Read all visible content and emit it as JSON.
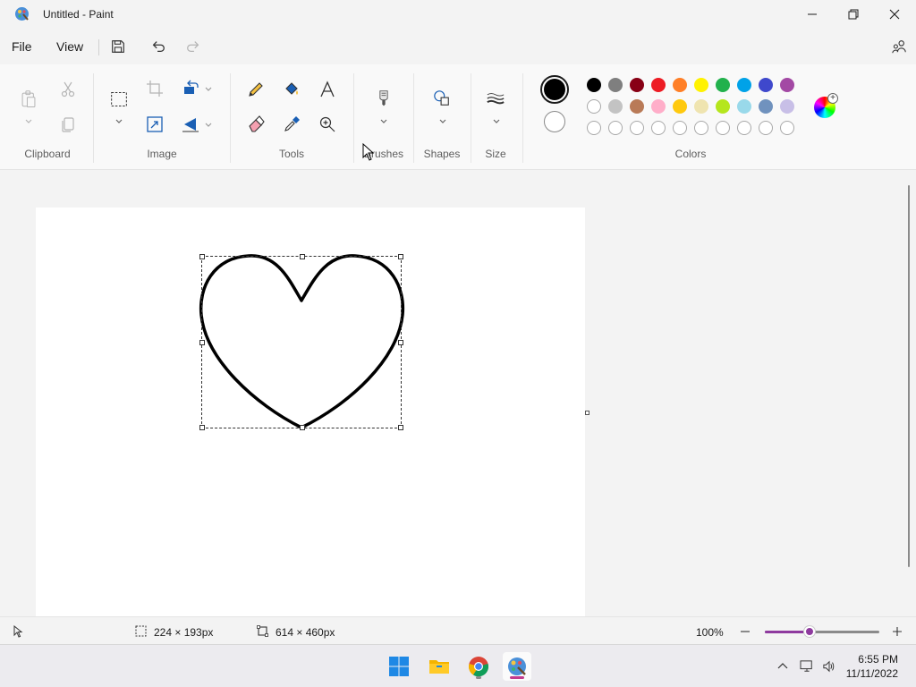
{
  "window": {
    "title": "Untitled - Paint"
  },
  "menu": {
    "file": "File",
    "view": "View"
  },
  "ribbon": {
    "groups": {
      "clipboard": "Clipboard",
      "image": "Image",
      "tools": "Tools",
      "brushes": "Brushes",
      "shapes": "Shapes",
      "size": "Size",
      "colors": "Colors"
    },
    "palette_row1": [
      "#000000",
      "#7f7f7f",
      "#880015",
      "#ed1c24",
      "#ff7f27",
      "#fff200",
      "#22b14c",
      "#00a2e8",
      "#3f48cc",
      "#a349a4"
    ],
    "palette_row2": [
      "#ffffff",
      "#c3c3c3",
      "#b97a57",
      "#ffaec9",
      "#ffc90e",
      "#efe4b0",
      "#b5e61d",
      "#99d9ea",
      "#7092be",
      "#c8bfe7"
    ],
    "primary_color": "#000000",
    "secondary_color": "#ffffff"
  },
  "status": {
    "selection_size": "224 × 193px",
    "canvas_size": "614 × 460px",
    "zoom": "100%",
    "zoom_fraction": 0.39
  },
  "taskbar": {
    "time": "6:55 PM",
    "date": "11/11/2022"
  }
}
